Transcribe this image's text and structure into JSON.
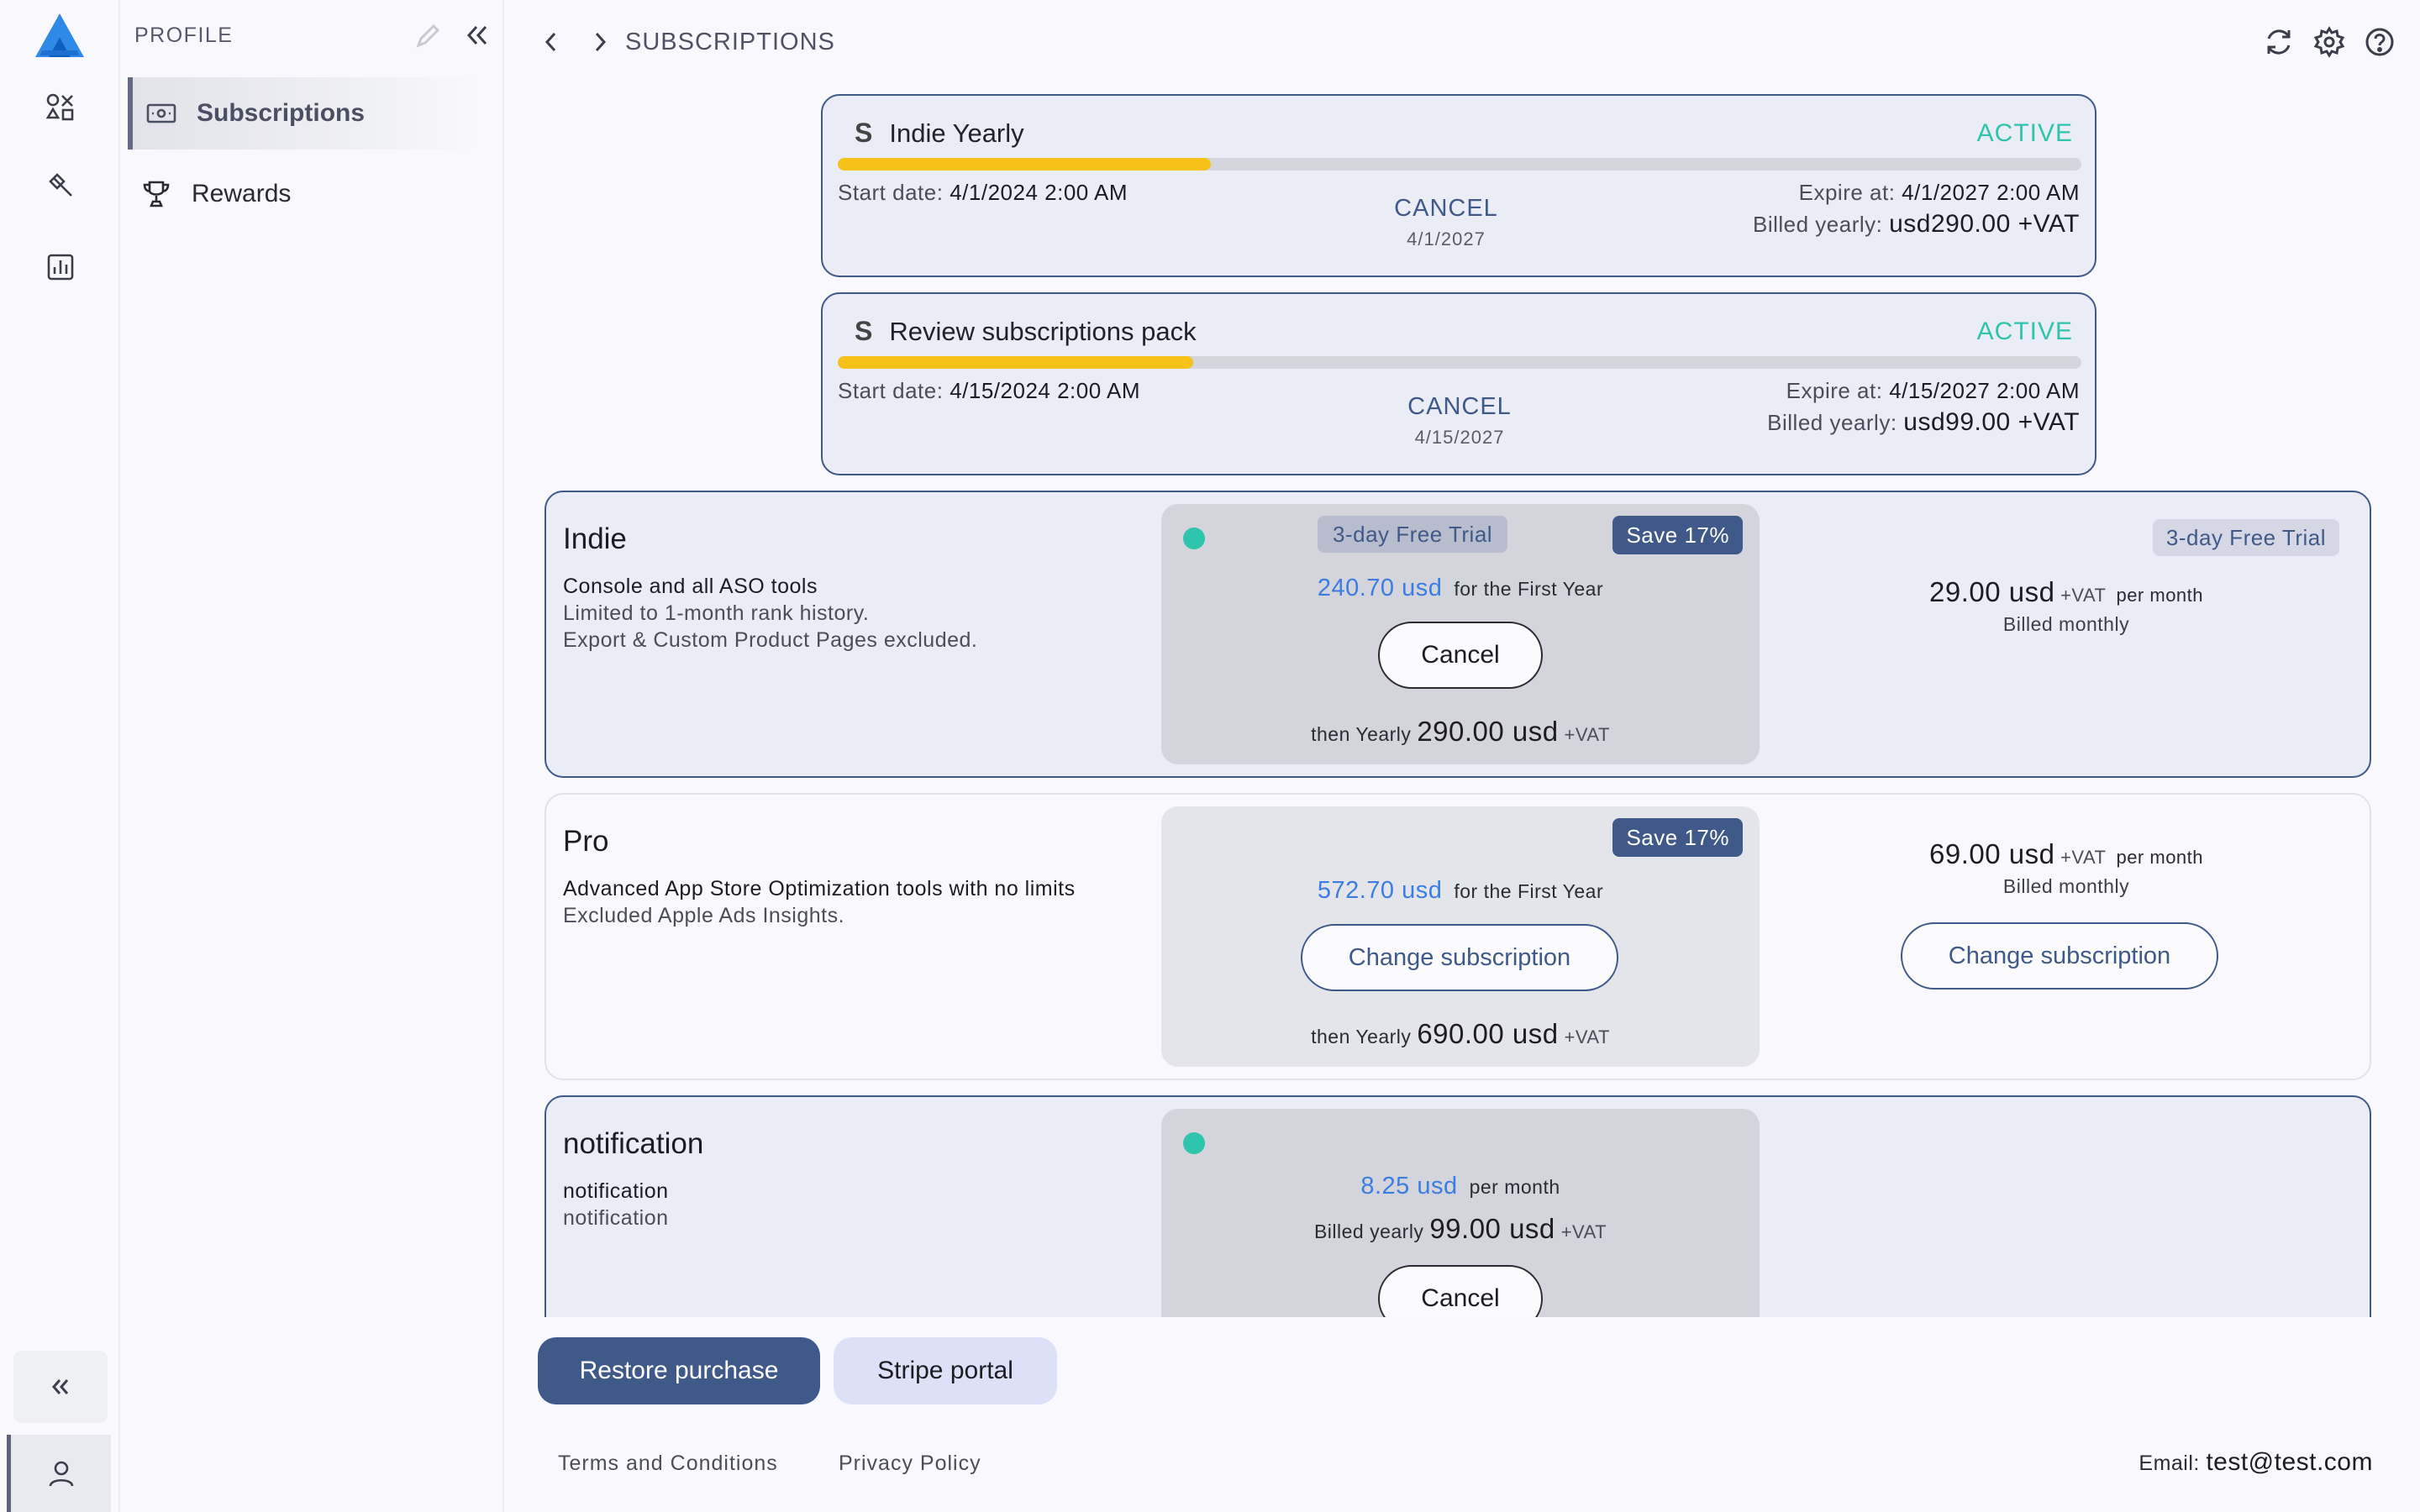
{
  "sidebar": {
    "title": "PROFILE",
    "items": [
      {
        "label": "Subscriptions",
        "icon": "money-icon"
      },
      {
        "label": "Rewards",
        "icon": "trophy-icon"
      }
    ]
  },
  "header": {
    "breadcrumb": "SUBSCRIPTIONS"
  },
  "active_subscriptions": [
    {
      "name": "Indie Yearly",
      "status": "ACTIVE",
      "progress": 0.3,
      "start_label": "Start date:",
      "start_value": "4/1/2024 2:00 AM",
      "cancel_label": "CANCEL",
      "cancel_date": "4/1/2027",
      "expire_label": "Expire at:",
      "expire_value": "4/1/2027 2:00 AM",
      "billed_label": "Billed yearly:",
      "billed_value": "usd290.00 +VAT"
    },
    {
      "name": "Review subscriptions pack",
      "status": "ACTIVE",
      "progress": 0.286,
      "start_label": "Start date:",
      "start_value": "4/15/2024 2:00 AM",
      "cancel_label": "CANCEL",
      "cancel_date": "4/15/2027",
      "expire_label": "Expire at:",
      "expire_value": "4/15/2027 2:00 AM",
      "billed_label": "Billed yearly:",
      "billed_value": "usd99.00 +VAT"
    }
  ],
  "plans": [
    {
      "name": "Indie",
      "desc1": "Console and all ASO tools",
      "desc2": "Limited to 1-month rank history.",
      "desc3": "Export & Custom Product Pages excluded.",
      "yearly": {
        "trial_badge": "3-day Free Trial",
        "save_badge": "Save 17%",
        "first_price": "240.70 usd",
        "first_suffix": "for the First Year",
        "button": "Cancel",
        "then_label": "then Yearly",
        "then_price": "290.00 usd",
        "vat": "+VAT"
      },
      "monthly": {
        "trial_badge": "3-day Free Trial",
        "price": "29.00 usd",
        "vat": "+VAT",
        "per": "per month",
        "billed": "Billed monthly"
      }
    },
    {
      "name": "Pro",
      "desc1": "Advanced App Store Optimization tools with no limits",
      "desc2": "Excluded Apple Ads Insights.",
      "yearly": {
        "save_badge": "Save 17%",
        "first_price": "572.70 usd",
        "first_suffix": "for the First Year",
        "button": "Change subscription",
        "then_label": "then Yearly",
        "then_price": "690.00 usd",
        "vat": "+VAT"
      },
      "monthly": {
        "price": "69.00 usd",
        "vat": "+VAT",
        "per": "per month",
        "billed": "Billed monthly",
        "button": "Change subscription"
      }
    },
    {
      "name": "notification",
      "desc1": "notification",
      "desc2": "notification",
      "yearly": {
        "price": "8.25 usd",
        "per": "per month",
        "billed_label": "Billed yearly",
        "billed_price": "99.00 usd",
        "vat": "+VAT",
        "button": "Cancel"
      }
    }
  ],
  "actions": {
    "restore": "Restore purchase",
    "stripe": "Stripe portal"
  },
  "footer": {
    "terms": "Terms and Conditions",
    "privacy": "Privacy Policy",
    "email_label": "Email:",
    "email_value": "test@test.com"
  },
  "colors": {
    "accent": "#3f5a88",
    "active": "#2ec5ac",
    "progress": "#f6c21a",
    "link_price": "#3b7de0"
  }
}
